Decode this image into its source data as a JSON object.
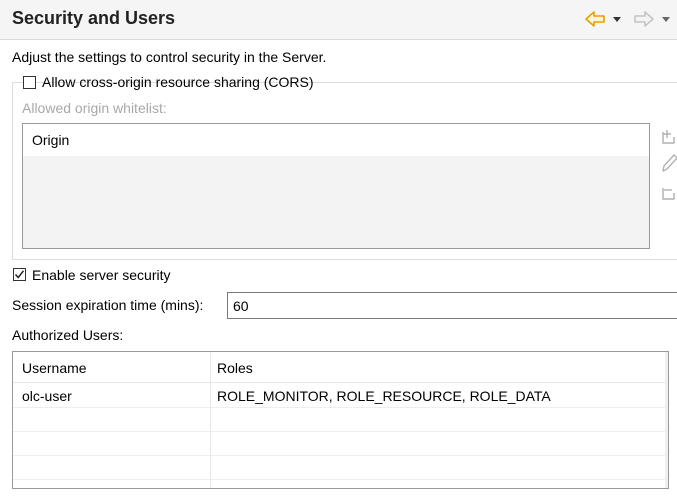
{
  "header": {
    "title": "Security and Users",
    "back_color": "#e4a200",
    "forward_color": "#c4c4c4"
  },
  "description": "Adjust the settings to control security in the Server.",
  "cors": {
    "checkbox_label": "Allow cross-origin resource sharing (CORS)",
    "checked": false,
    "whitelist_label": "Allowed origin whitelist:",
    "column_header": "Origin",
    "side_icons": [
      "add-icon",
      "edit-icon",
      "remove-icon"
    ]
  },
  "security": {
    "checkbox_label": "Enable server security",
    "checked": true
  },
  "session": {
    "label": "Session expiration time (mins):",
    "value": "60"
  },
  "users": {
    "label": "Authorized Users:",
    "columns": [
      "Username",
      "Roles"
    ],
    "rows": [
      {
        "username": "olc-user",
        "roles": "ROLE_MONITOR, ROLE_RESOURCE, ROLE_DATA"
      }
    ]
  }
}
